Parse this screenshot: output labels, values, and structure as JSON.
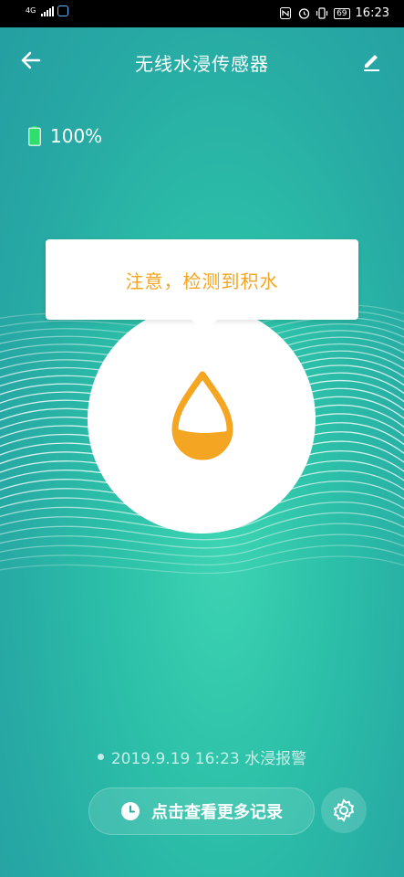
{
  "status_bar": {
    "network": "4G",
    "time": "16:23",
    "battery_level": "69",
    "icons": [
      "signal-icon",
      "home-app-icon",
      "nfc-icon",
      "alarm-icon",
      "vibrate-icon",
      "battery-icon"
    ]
  },
  "header": {
    "title": "无线水浸传感器",
    "back_icon": "arrow-left-icon",
    "edit_icon": "pencil-icon"
  },
  "battery": {
    "text": "100%",
    "level": 1.0,
    "color": "#2ee06b"
  },
  "alert": {
    "message": "注意，检测到积水",
    "color": "#f4a522"
  },
  "last_record": {
    "text": "2019.9.19 16:23 水浸报警"
  },
  "actions": {
    "more_records_label": "点击查看更多记录",
    "clock_icon": "clock-icon",
    "settings_icon": "gear-icon"
  },
  "colors": {
    "background_top": "#249ea2",
    "background_center": "#3dd4b3",
    "accent": "#f4a522"
  }
}
